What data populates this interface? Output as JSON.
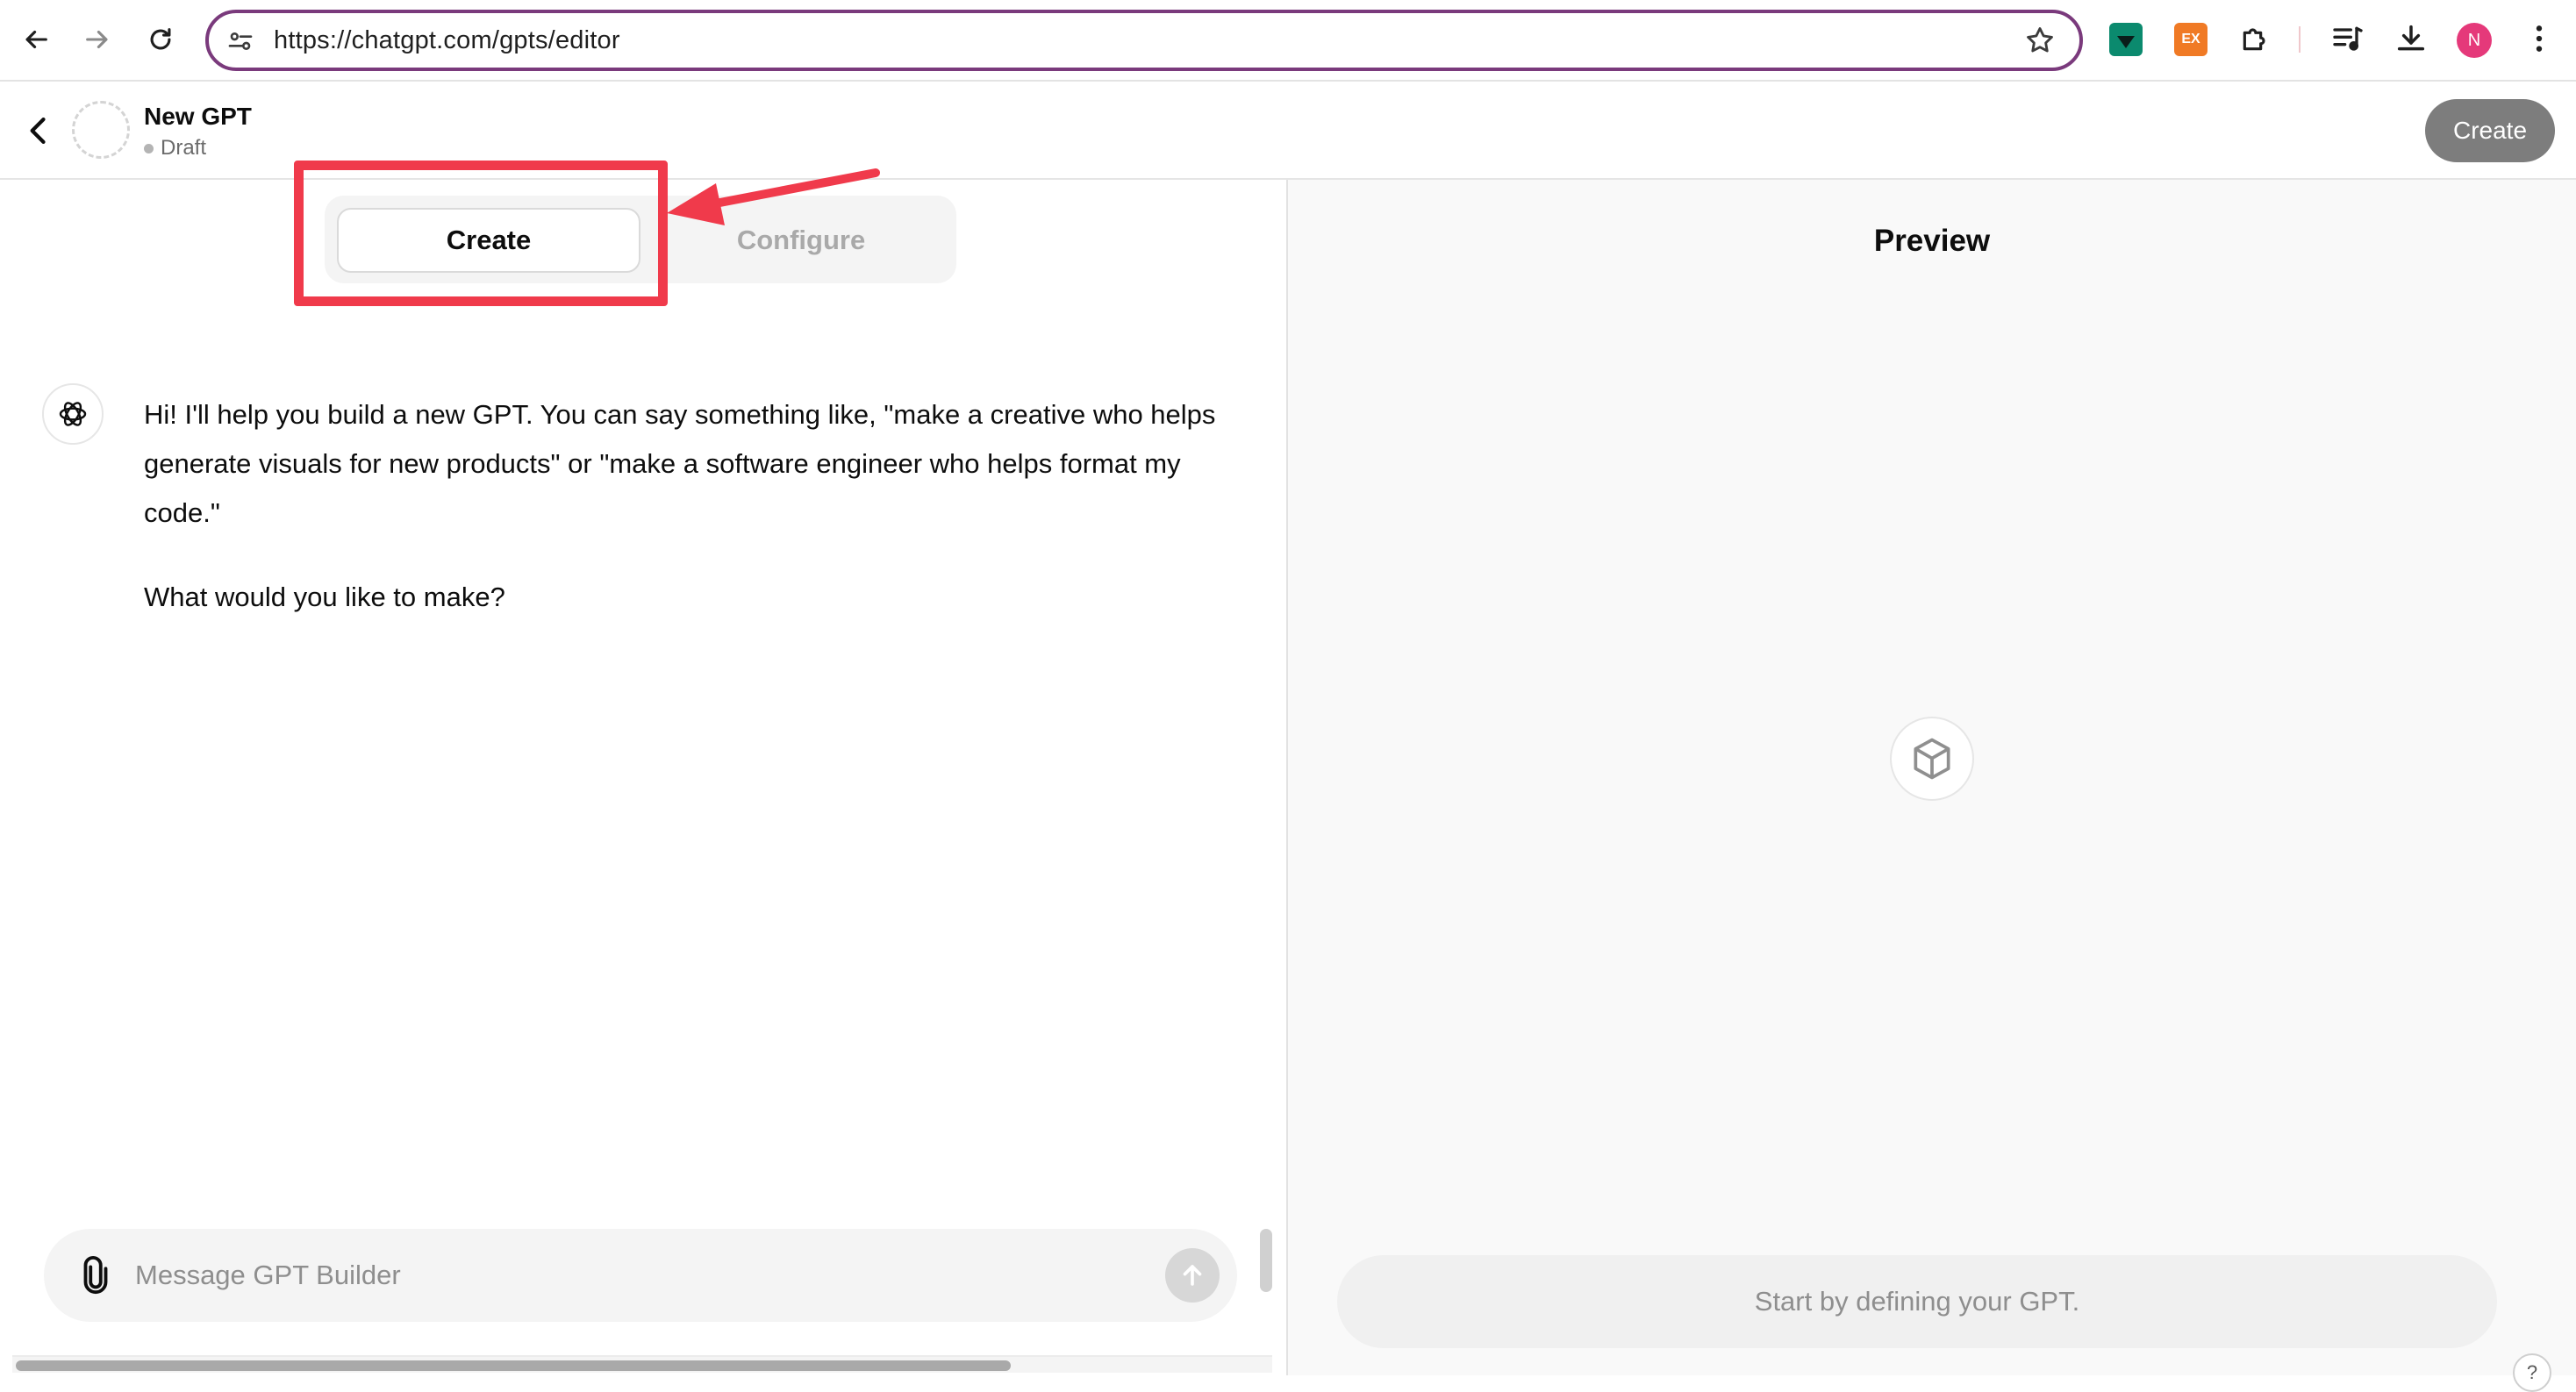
{
  "browser": {
    "url": "https://chatgpt.com/gpts/editor",
    "profile_initial": "N",
    "extension_ex_label": "EX"
  },
  "header": {
    "gpt_name": "New GPT",
    "status": "Draft",
    "create_button": "Create"
  },
  "tabs": [
    {
      "label": "Create",
      "active": true
    },
    {
      "label": "Configure",
      "active": false
    }
  ],
  "chat": {
    "messages": [
      "Hi! I'll help you build a new GPT. You can say something like, \"make a creative who helps generate visuals for new products\" or \"make a software engineer who helps format my code.\"",
      "What would you like to make?"
    ],
    "composer_placeholder": "Message GPT Builder"
  },
  "preview": {
    "title": "Preview",
    "input_placeholder": "Start by defining your GPT.",
    "help_label": "?"
  },
  "annotation": {
    "highlight_color": "#f03a4b"
  },
  "colors": {
    "omnibox_border": "#7a3a7c",
    "avatar": "#e5397a",
    "header_create": "#7d7d7d"
  }
}
